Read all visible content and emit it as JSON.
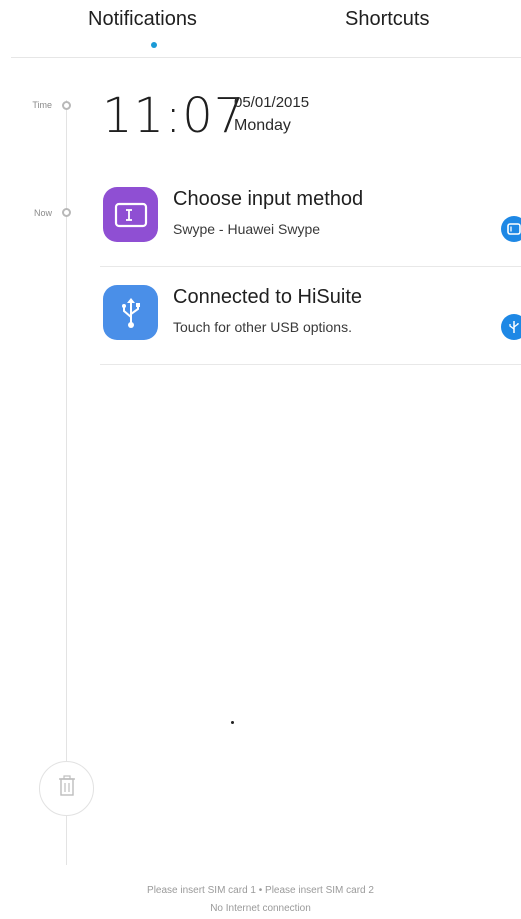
{
  "tabs": [
    {
      "label": "Notifications",
      "selected": true
    },
    {
      "label": "Shortcuts",
      "selected": false
    }
  ],
  "colors": {
    "accent": "#1a9ad6",
    "swype_icon_bg": "#8f4fd3",
    "hisuite_icon_bg": "#4a8fe8",
    "badge_blue": "#1e88e5"
  },
  "timeline": {
    "time_label": "Time",
    "now_label": "Now"
  },
  "clock": {
    "time": "11:07",
    "date": "05/01/2015",
    "day": "Monday"
  },
  "notifications": [
    {
      "title": "Choose input method",
      "subtitle": "Swype - Huawei Swype",
      "icon": "keyboard-input-icon"
    },
    {
      "title": "Connected to HiSuite",
      "subtitle": "Touch for other USB options.",
      "icon": "usb-icon"
    }
  ],
  "clear_button_icon": "trash-icon",
  "footer": {
    "sim_status": "Please insert SIM card 1 • Please insert SIM card 2",
    "network_status": "No Internet connection"
  }
}
